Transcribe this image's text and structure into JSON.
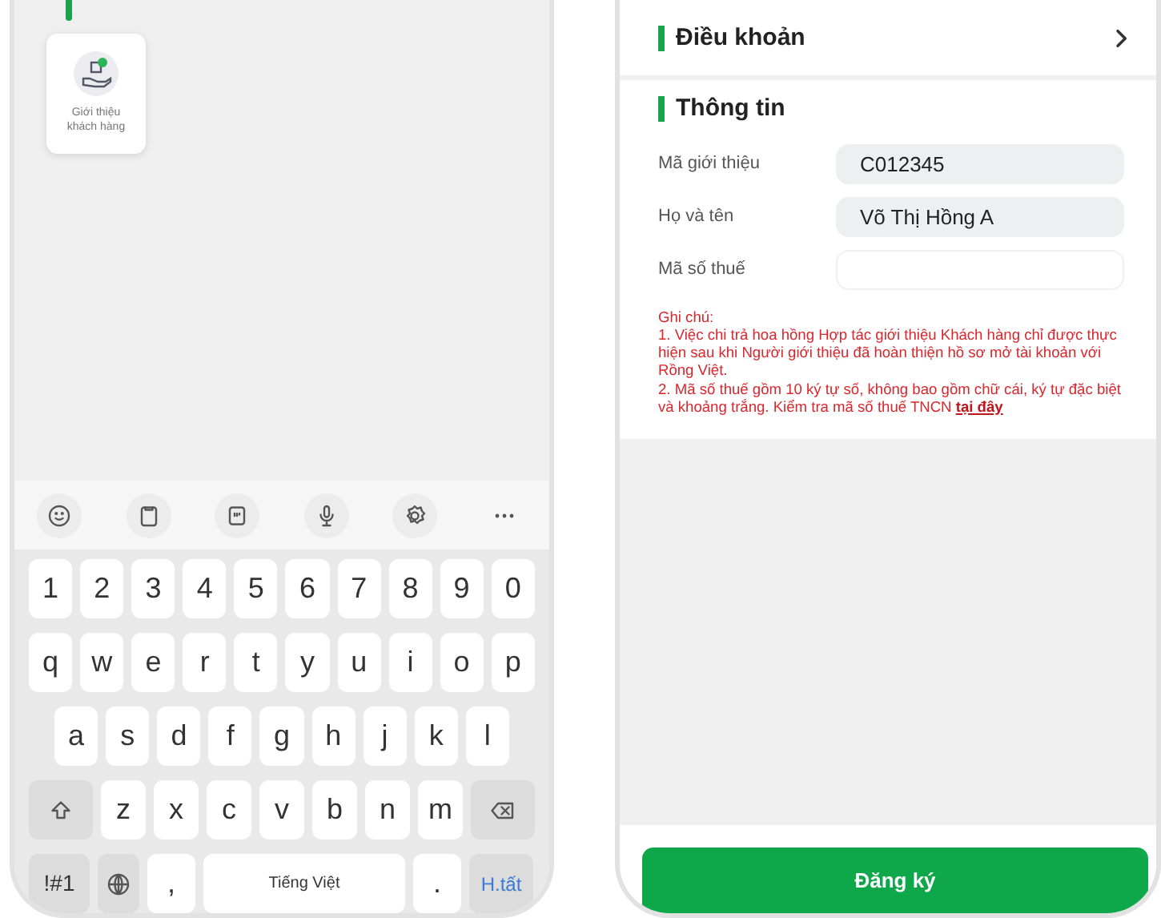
{
  "left_screen": {
    "tiles": [
      {
        "label": "Giới thiệu khách hàng"
      }
    ]
  },
  "keyboard": {
    "rows": [
      {
        "keys": [
          {
            "kind": "char",
            "label": "1"
          },
          {
            "kind": "char",
            "label": "2"
          },
          {
            "kind": "char",
            "label": "3"
          },
          {
            "kind": "char",
            "label": "4"
          },
          {
            "kind": "char",
            "label": "5"
          },
          {
            "kind": "char",
            "label": "6"
          },
          {
            "kind": "char",
            "label": "7"
          },
          {
            "kind": "char",
            "label": "8"
          },
          {
            "kind": "char",
            "label": "9"
          },
          {
            "kind": "char",
            "label": "0"
          }
        ]
      },
      {
        "keys": [
          {
            "kind": "char",
            "label": "q"
          },
          {
            "kind": "char",
            "label": "w"
          },
          {
            "kind": "char",
            "label": "e"
          },
          {
            "kind": "char",
            "label": "r"
          },
          {
            "kind": "char",
            "label": "t"
          },
          {
            "kind": "char",
            "label": "y"
          },
          {
            "kind": "char",
            "label": "u"
          },
          {
            "kind": "char",
            "label": "i"
          },
          {
            "kind": "char",
            "label": "o"
          },
          {
            "kind": "char",
            "label": "p"
          }
        ]
      },
      {
        "keys": [
          {
            "kind": "char",
            "label": "a"
          },
          {
            "kind": "char",
            "label": "s"
          },
          {
            "kind": "char",
            "label": "d"
          },
          {
            "kind": "char",
            "label": "f"
          },
          {
            "kind": "char",
            "label": "g"
          },
          {
            "kind": "char",
            "label": "h"
          },
          {
            "kind": "char",
            "label": "j"
          },
          {
            "kind": "char",
            "label": "k"
          },
          {
            "kind": "char",
            "label": "l"
          }
        ]
      },
      {
        "keys": [
          {
            "kind": "shift"
          },
          {
            "kind": "char",
            "label": "z"
          },
          {
            "kind": "char",
            "label": "x"
          },
          {
            "kind": "char",
            "label": "c"
          },
          {
            "kind": "char",
            "label": "v"
          },
          {
            "kind": "char",
            "label": "b"
          },
          {
            "kind": "char",
            "label": "n"
          },
          {
            "kind": "char",
            "label": "m"
          },
          {
            "kind": "backspace"
          }
        ]
      },
      {
        "keys": [
          {
            "kind": "symbols",
            "label": "!#1"
          },
          {
            "kind": "globe"
          },
          {
            "kind": "char",
            "label": ","
          },
          {
            "kind": "space",
            "label": "Tiếng Việt"
          },
          {
            "kind": "char",
            "label": "."
          },
          {
            "kind": "action",
            "label": "H.tất"
          }
        ]
      }
    ]
  },
  "right_screen": {
    "terms": {
      "title": "Điều khoản"
    },
    "info": {
      "title": "Thông tin",
      "fields": [
        {
          "label": "Mã giới thiệu",
          "value": "C012345",
          "disabled": true
        },
        {
          "label": "Họ và tên",
          "value": "Võ Thị Hồng A",
          "disabled": true
        },
        {
          "label": "Mã số thuế",
          "disabled": false
        }
      ],
      "note": {
        "lines": [
          "Ghi chú:",
          "1. Việc chi trả hoa hồng Hợp tác giới thiệu Khách hàng chỉ được thực hiện sau khi Người giới thiệu đã hoàn thiện hồ sơ mở tài khoản với Rồng Việt.",
          "2. Mã số thuế gồm 10 ký tự số, không bao gồm chữ cái, ký tự đặc biệt và khoảng trắng. Kiểm tra mã số thuế TNCN"
        ],
        "link": "tại đây"
      }
    },
    "submit_button": "Đăng ký"
  }
}
